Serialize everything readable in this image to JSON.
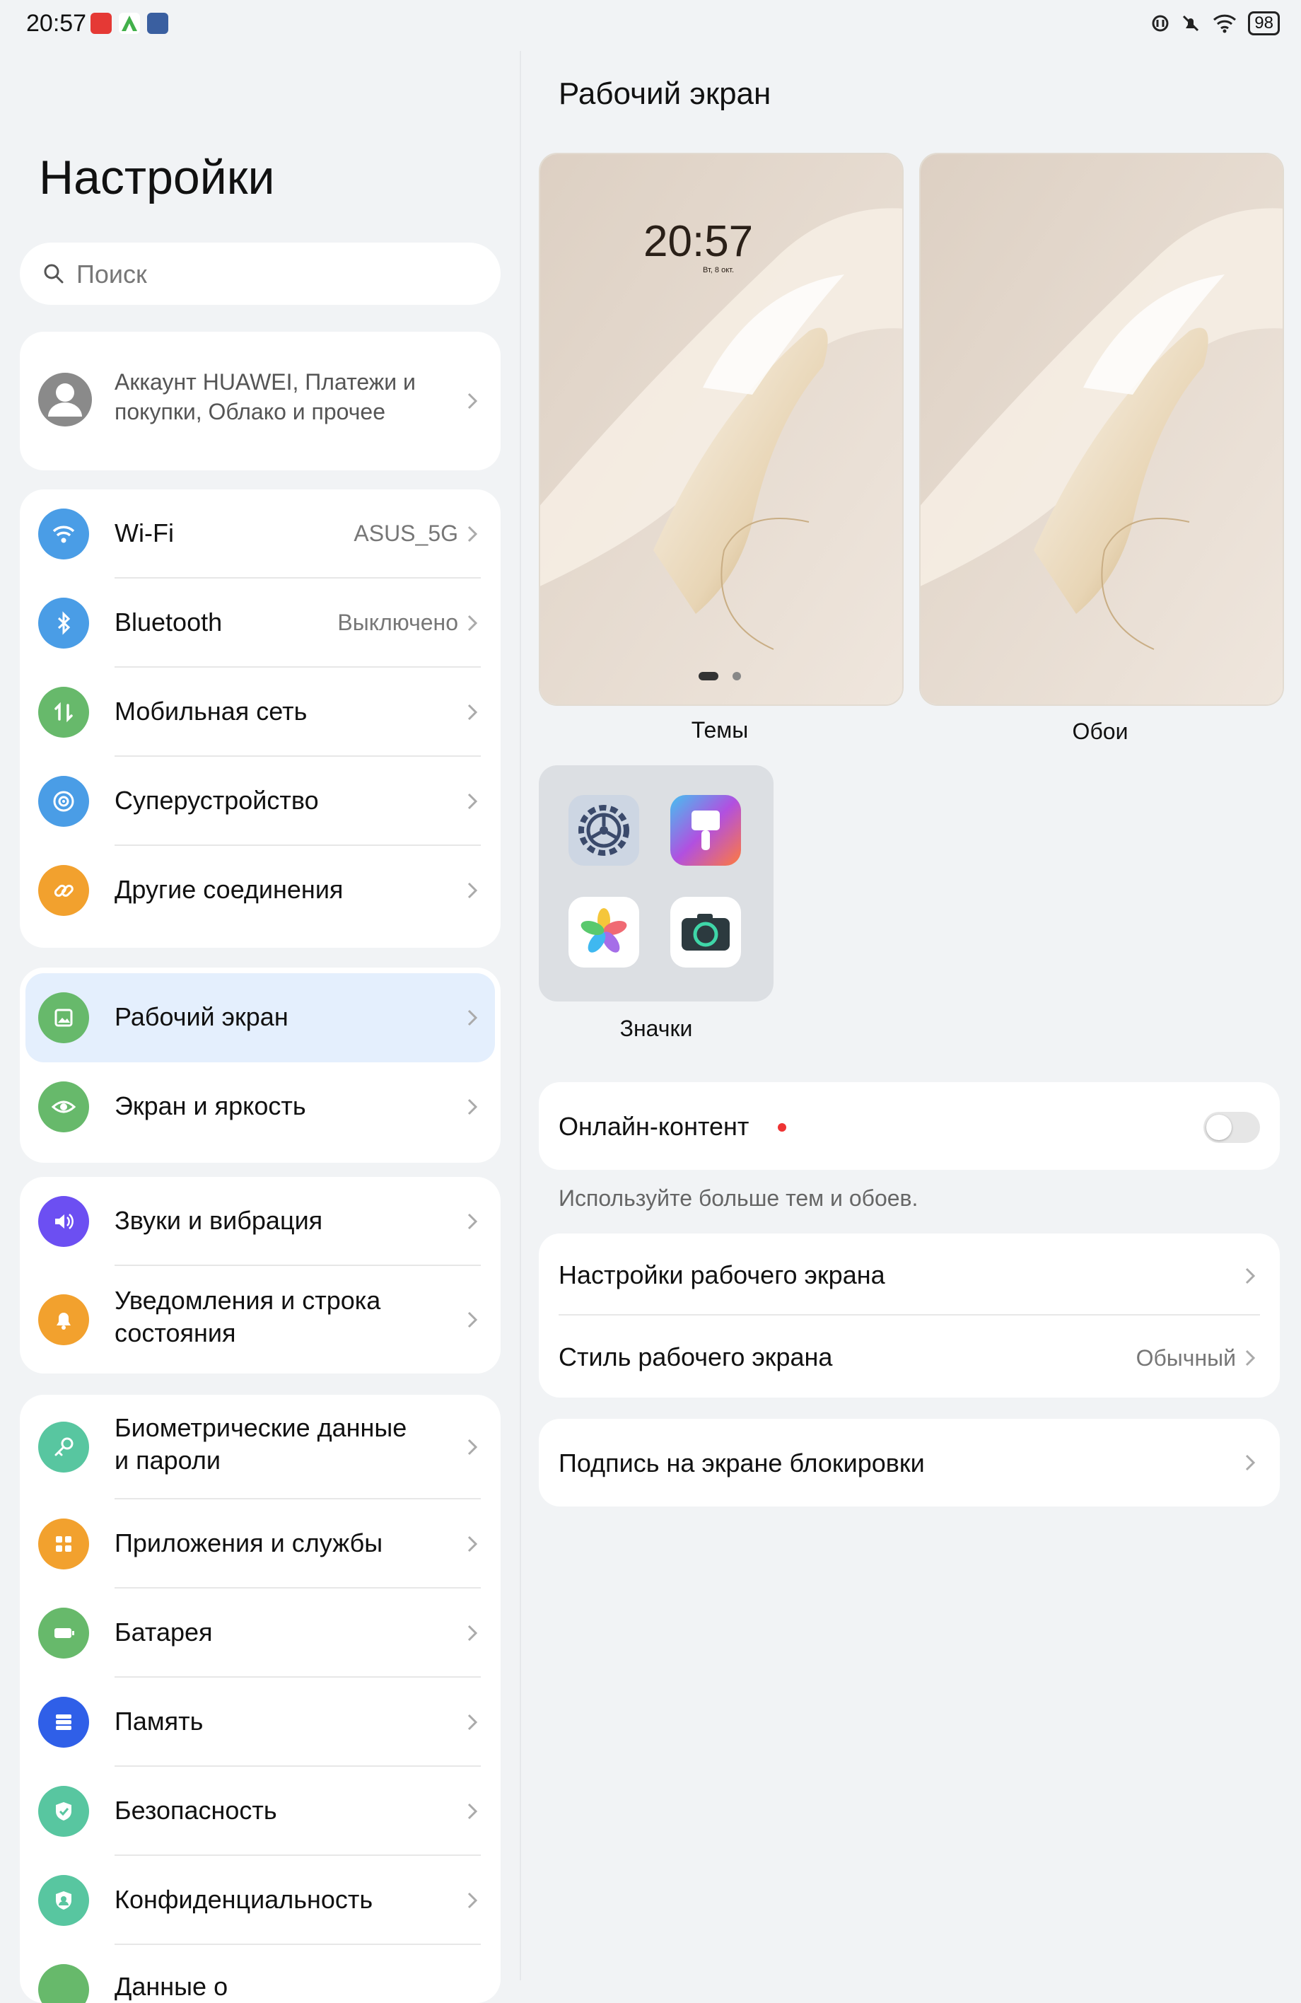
{
  "status_bar": {
    "time": "20:57",
    "battery": "98"
  },
  "left": {
    "title": "Настройки",
    "search_placeholder": "Поиск",
    "account_text_line1": "Аккаунт HUAWEI, Платежи и",
    "account_text_line2": "покупки, Облако и прочее",
    "groups": [
      [
        {
          "label": "Wi-Fi",
          "value": "ASUS_5G",
          "icon": "wifi-icon",
          "color": "#4a9de6"
        },
        {
          "label": "Bluetooth",
          "value": "Выключено",
          "icon": "bluetooth-icon",
          "color": "#4a9de6"
        },
        {
          "label": "Мобильная сеть",
          "value": "",
          "icon": "mobile-data-icon",
          "color": "#67b96b"
        },
        {
          "label": "Суперустройство",
          "value": "",
          "icon": "super-device-icon",
          "color": "#4a9de6"
        },
        {
          "label": "Другие соединения",
          "value": "",
          "icon": "link-icon",
          "color": "#f2a12e"
        }
      ],
      [
        {
          "label": "Рабочий экран",
          "value": "",
          "icon": "wallpaper-icon",
          "color": "#67b96b",
          "selected": true
        },
        {
          "label": "Экран и яркость",
          "value": "",
          "icon": "eye-icon",
          "color": "#67b96b"
        }
      ],
      [
        {
          "label": "Звуки и вибрация",
          "value": "",
          "icon": "sound-icon",
          "color": "#6c4ff2"
        },
        {
          "label": "Уведомления и строка состояния",
          "label_l1": "Уведомления и строка",
          "label_l2": "состояния",
          "value": "",
          "icon": "bell-icon",
          "color": "#f2a12e"
        }
      ],
      [
        {
          "label": "Биометрические данные и пароли",
          "label_l1": "Биометрические данные",
          "label_l2": "и пароли",
          "value": "",
          "icon": "key-icon",
          "color": "#58c6a0"
        },
        {
          "label": "Приложения и службы",
          "value": "",
          "icon": "apps-icon",
          "color": "#f2a12e"
        },
        {
          "label": "Батарея",
          "value": "",
          "icon": "battery-icon",
          "color": "#67b96b"
        },
        {
          "label": "Память",
          "value": "",
          "icon": "storage-icon",
          "color": "#2f5fe8"
        },
        {
          "label": "Безопасность",
          "value": "",
          "icon": "shield-icon",
          "color": "#58c6a0"
        },
        {
          "label": "Конфиденциальность",
          "value": "",
          "icon": "privacy-icon",
          "color": "#58c6a0"
        },
        {
          "label": "Данные о",
          "value": "",
          "icon": "data-icon",
          "color": "#67b96b"
        }
      ]
    ]
  },
  "right": {
    "title": "Рабочий экран",
    "preview_time": "20:57",
    "preview_date": "Вт, 8 окт.",
    "themes_label": "Темы",
    "wallpaper_label": "Обои",
    "icons_label": "Значки",
    "online_content_label": "Онлайн-контент",
    "online_hint": "Используйте больше тем и обоев.",
    "home_settings_label": "Настройки рабочего экрана",
    "home_style_label": "Стиль рабочего экрана",
    "home_style_value": "Обычный",
    "lock_signature_label": "Подпись на экране блокировки"
  }
}
